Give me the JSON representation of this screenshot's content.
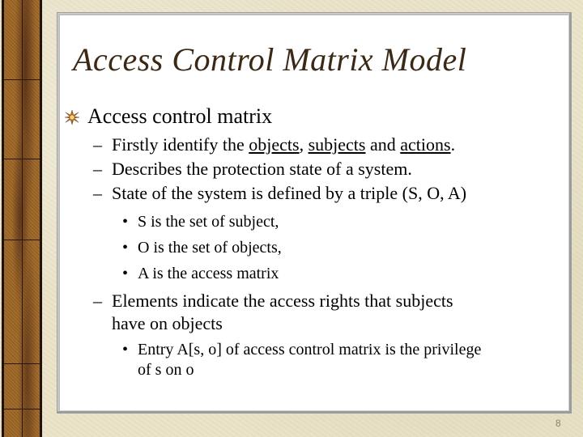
{
  "slide": {
    "title": "Access Control Matrix Model",
    "bullet": "Access control matrix",
    "sub_items": {
      "first": {
        "prefix": "Firstly identify the ",
        "u1": "objects",
        "sep1": ", ",
        "u2": "subjects",
        "sep2": " and ",
        "u3": "actions",
        "suffix": "."
      },
      "second": "Describes the protection state of a system.",
      "third": "State of the system is defined by a triple (S, O, A)",
      "triple_items": [
        "S is the set of subject,",
        "O is the set of objects,",
        "A is the access matrix"
      ],
      "fourth_line1": "Elements indicate the access rights that subjects",
      "fourth_line2": "have on objects",
      "entry_line1": "Entry A[s, o] of access control matrix is the privilege",
      "entry_line2": "of s on o"
    },
    "dash_glyph": "–",
    "dot_glyph": "•",
    "bullet_icon": "star-burst-icon",
    "page_number": "8"
  },
  "colors": {
    "title": "#3b2815",
    "background": "#e9e2c8",
    "strip": "#9a6426"
  }
}
